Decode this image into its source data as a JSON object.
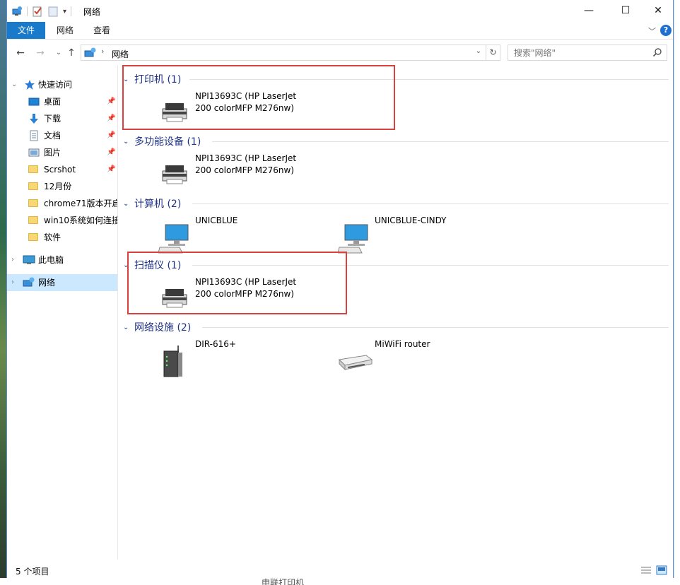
{
  "window": {
    "title": "网络",
    "minimize": "—",
    "maximize": "☐",
    "close": "✕"
  },
  "ribbon": {
    "tabs": [
      "文件",
      "网络",
      "查看"
    ],
    "help": "?"
  },
  "address": {
    "crumb": "网络",
    "search_placeholder": "搜索\"网络\""
  },
  "sidebar": {
    "items": [
      {
        "label": "快速访问",
        "icon": "star-icon"
      },
      {
        "label": "桌面",
        "icon": "desktop-icon",
        "pinned": true
      },
      {
        "label": "下载",
        "icon": "download-icon",
        "pinned": true
      },
      {
        "label": "文档",
        "icon": "document-icon",
        "pinned": true
      },
      {
        "label": "图片",
        "icon": "pictures-icon",
        "pinned": true
      },
      {
        "label": "Scrshot",
        "icon": "folder-icon",
        "pinned": true
      },
      {
        "label": "12月份",
        "icon": "folder-icon"
      },
      {
        "label": "chrome71版本开启",
        "icon": "folder-icon"
      },
      {
        "label": "win10系统如何连接",
        "icon": "folder-icon"
      },
      {
        "label": "软件",
        "icon": "folder-icon"
      },
      {
        "label": "此电脑",
        "icon": "computer-icon"
      },
      {
        "label": "网络",
        "icon": "network-icon",
        "selected": true
      }
    ]
  },
  "groups": [
    {
      "title": "打印机 (1)",
      "items": [
        {
          "line1": "NPI13693C (HP LaserJet",
          "line2": "200 colorMFP M276nw)",
          "icon": "printer-icon"
        }
      ]
    },
    {
      "title": "多功能设备 (1)",
      "items": [
        {
          "line1": "NPI13693C (HP LaserJet",
          "line2": "200 colorMFP M276nw)",
          "icon": "printer-icon"
        }
      ]
    },
    {
      "title": "计算机 (2)",
      "items": [
        {
          "line1": "UNICBLUE",
          "line2": "",
          "icon": "computer-monitor-icon"
        },
        {
          "line1": "UNICBLUE-CINDY",
          "line2": "",
          "icon": "computer-monitor-icon"
        }
      ]
    },
    {
      "title": "扫描仪 (1)",
      "items": [
        {
          "line1": "NPI13693C (HP LaserJet",
          "line2": "200 colorMFP M276nw)",
          "icon": "scanner-icon"
        }
      ]
    },
    {
      "title": "网络设施 (2)",
      "items": [
        {
          "line1": "DIR-616+",
          "line2": "",
          "icon": "router-tower-icon"
        },
        {
          "line1": "MiWiFi router",
          "line2": "",
          "icon": "router-flat-icon"
        }
      ]
    }
  ],
  "status": {
    "count": "5 个项目"
  },
  "background": {
    "bottom_text": "申联打印机"
  },
  "colors": {
    "accent": "#1979ca",
    "group_title": "#1e3287",
    "highlight_box": "#d9413f",
    "selection": "#cce8ff"
  }
}
